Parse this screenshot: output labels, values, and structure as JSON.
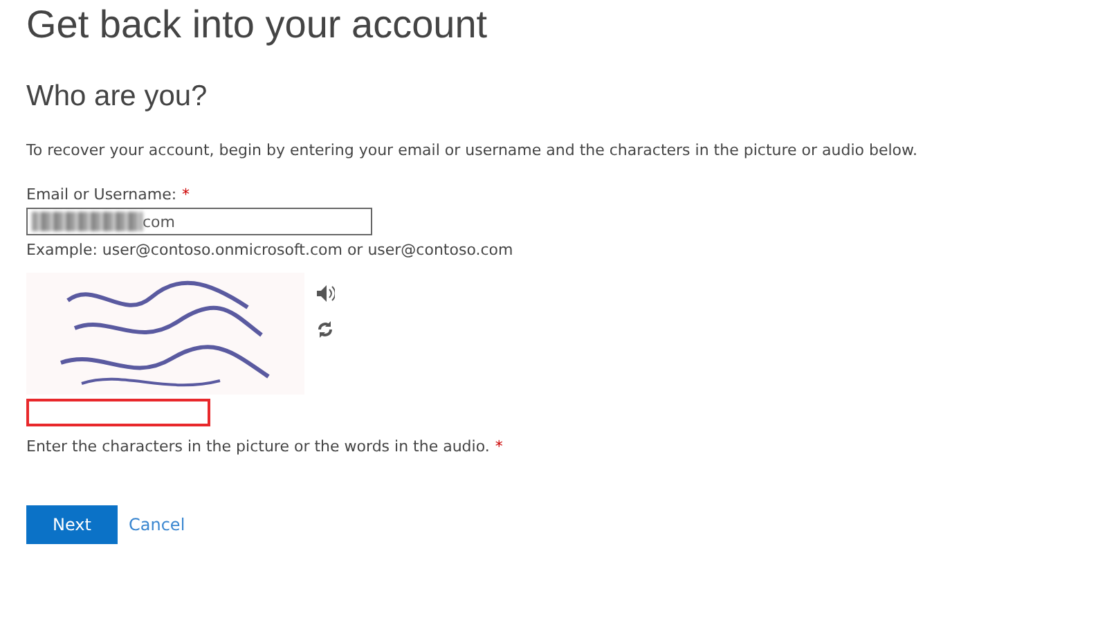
{
  "title": "Get back into your account",
  "subtitle": "Who are you?",
  "intro": "To recover your account, begin by entering your email or username and the characters in the picture or audio below.",
  "email": {
    "label": "Email or Username:",
    "required_mark": "*",
    "value": "com",
    "example": "Example: user@contoso.onmicrosoft.com or user@contoso.com"
  },
  "captcha": {
    "kind": "picture",
    "label": "Enter the characters in the picture or the words in the audio.",
    "required_mark": "*",
    "invalid": true
  },
  "buttons": {
    "primary": "Next",
    "secondary": "Cancel"
  }
}
